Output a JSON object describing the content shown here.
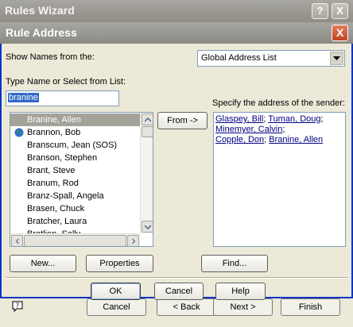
{
  "background_window": {
    "title": "Rules Wizard",
    "help_button": "?",
    "close_button": "X",
    "buttons": {
      "cancel": "Cancel",
      "back": "< Back",
      "next": "Next >",
      "finish": "Finish"
    }
  },
  "dialog": {
    "title": "Rule Address",
    "close_button": "X",
    "show_names_label": "Show Names from the:",
    "address_book": {
      "selected": "Global Address List"
    },
    "type_name_label": "Type Name or Select from List:",
    "name_input": {
      "value": "branine"
    },
    "name_list": [
      {
        "name": "Branine, Allen",
        "selected": true,
        "icon": ""
      },
      {
        "name": "Brannon, Bob",
        "selected": false,
        "icon": "globe-icon"
      },
      {
        "name": "Branscum, Jean (SOS)",
        "selected": false,
        "icon": ""
      },
      {
        "name": "Branson, Stephen",
        "selected": false,
        "icon": ""
      },
      {
        "name": "Brant, Steve",
        "selected": false,
        "icon": ""
      },
      {
        "name": "Branum, Rod",
        "selected": false,
        "icon": ""
      },
      {
        "name": "Branz-Spall, Angela",
        "selected": false,
        "icon": ""
      },
      {
        "name": "Brasen, Chuck",
        "selected": false,
        "icon": ""
      },
      {
        "name": "Bratcher, Laura",
        "selected": false,
        "icon": ""
      },
      {
        "name": "Bratlien, Sally",
        "selected": false,
        "icon": ""
      }
    ],
    "from_button": "From ->",
    "specify_label": "Specify the address of the sender:",
    "addresses_text": {
      "a1": "Glaspey, Bill",
      "sep1": ";",
      "a2": "Tuman, Doug",
      "sep2": ";",
      "a3": "Minemyer, Calvin",
      "sep3": ";",
      "a4": "Copple, Don",
      "sep4": ";",
      "a5": "Branine, Allen"
    },
    "new_button": "New...",
    "properties_button": "Properties",
    "find_button": "Find...",
    "ok_button": "OK",
    "cancel_button": "Cancel",
    "help_button": "Help"
  }
}
